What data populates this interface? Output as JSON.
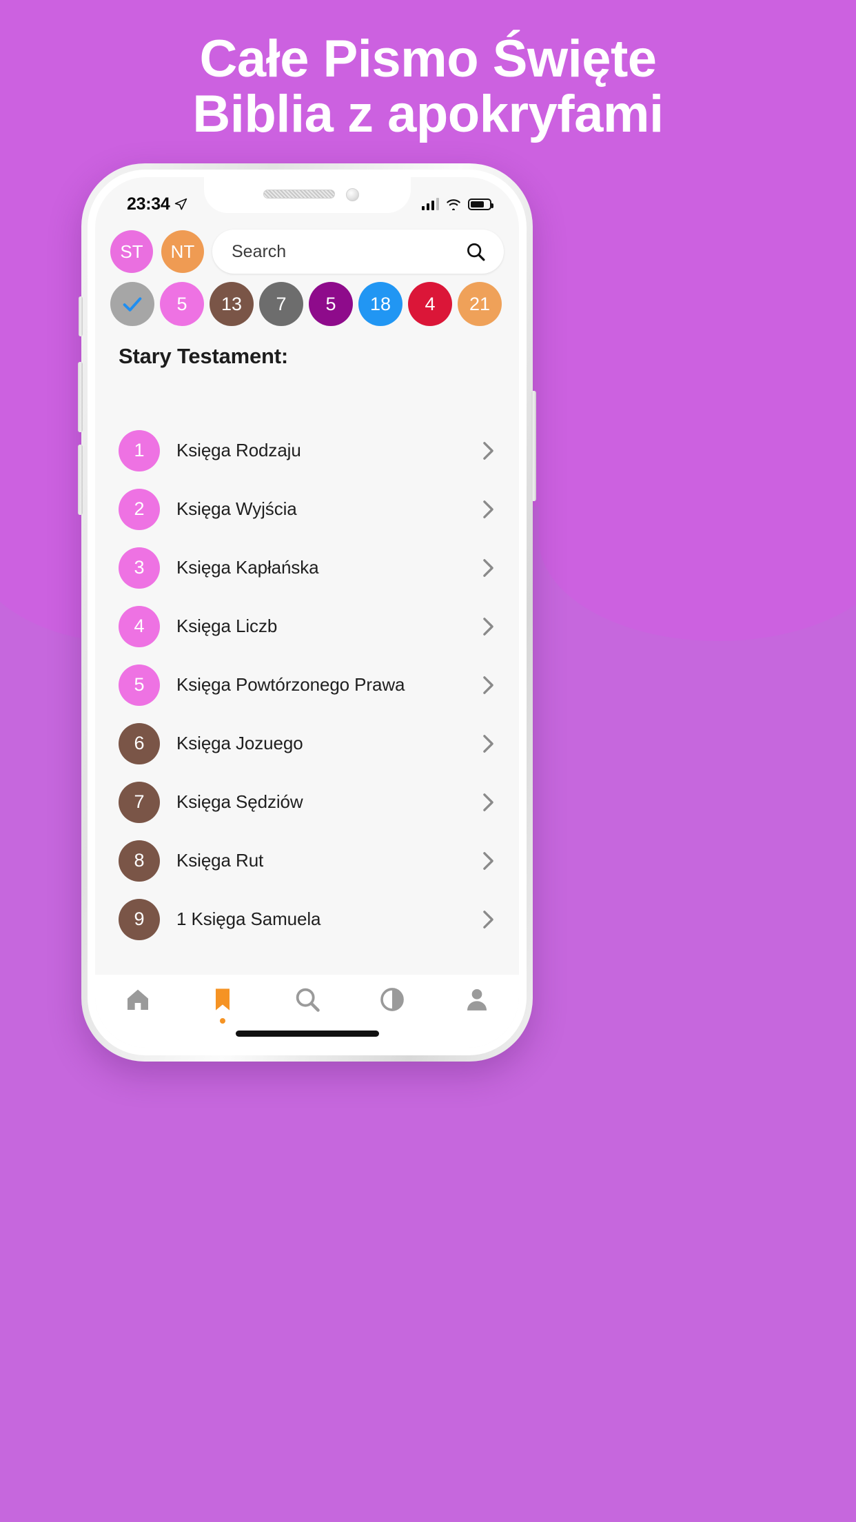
{
  "promo": {
    "background_color": "#cc61e0",
    "headline_line1": "Całe Pismo Święte",
    "headline_line2": "Biblia z apokryfami"
  },
  "status_bar": {
    "time": "23:34",
    "location_icon": "location-arrow-icon",
    "signal_icon": "cellular-bars-icon",
    "wifi_icon": "wifi-icon",
    "battery_icon": "battery-icon"
  },
  "top_controls": {
    "testaments": [
      {
        "label": "ST",
        "color": "#ea6fe0"
      },
      {
        "label": "NT",
        "color": "#ef9b53"
      }
    ],
    "search": {
      "placeholder": "Search",
      "value": "",
      "icon": "search-icon"
    },
    "chips": [
      {
        "label": "",
        "icon": "check-icon",
        "color": "#a6a6a6",
        "icon_color": "#1f8ef1"
      },
      {
        "label": "5",
        "color": "#ee72e3"
      },
      {
        "label": "13",
        "color": "#7a5547"
      },
      {
        "label": "7",
        "color": "#6d6d6d"
      },
      {
        "label": "5",
        "color": "#8e0b8b"
      },
      {
        "label": "18",
        "color": "#2196f3"
      },
      {
        "label": "4",
        "color": "#db1638"
      },
      {
        "label": "21",
        "color": "#efa159"
      }
    ]
  },
  "section": {
    "title": "Stary Testament:"
  },
  "books": [
    {
      "number": "1",
      "name": "Księga Rodzaju",
      "color": "#ee72e3"
    },
    {
      "number": "2",
      "name": "Księga Wyjścia",
      "color": "#ee72e3"
    },
    {
      "number": "3",
      "name": "Księga Kapłańska",
      "color": "#ee72e3"
    },
    {
      "number": "4",
      "name": "Księga Liczb",
      "color": "#ee72e3"
    },
    {
      "number": "5",
      "name": "Księga Powtórzonego Prawa",
      "color": "#ee72e3"
    },
    {
      "number": "6",
      "name": "Księga Jozuego",
      "color": "#7a5547"
    },
    {
      "number": "7",
      "name": "Księga Sędziów",
      "color": "#7a5547"
    },
    {
      "number": "8",
      "name": "Księga Rut",
      "color": "#7a5547"
    },
    {
      "number": "9",
      "name": "1 Księga Samuela",
      "color": "#7a5547"
    }
  ],
  "tabbar": {
    "items": [
      {
        "icon": "home-icon",
        "active": false
      },
      {
        "icon": "bookmark-icon",
        "active": true,
        "accent": "#f59324"
      },
      {
        "icon": "search-icon",
        "active": false
      },
      {
        "icon": "contrast-icon",
        "active": false
      },
      {
        "icon": "person-icon",
        "active": false
      }
    ],
    "inactive_color": "#9a9a9a"
  }
}
